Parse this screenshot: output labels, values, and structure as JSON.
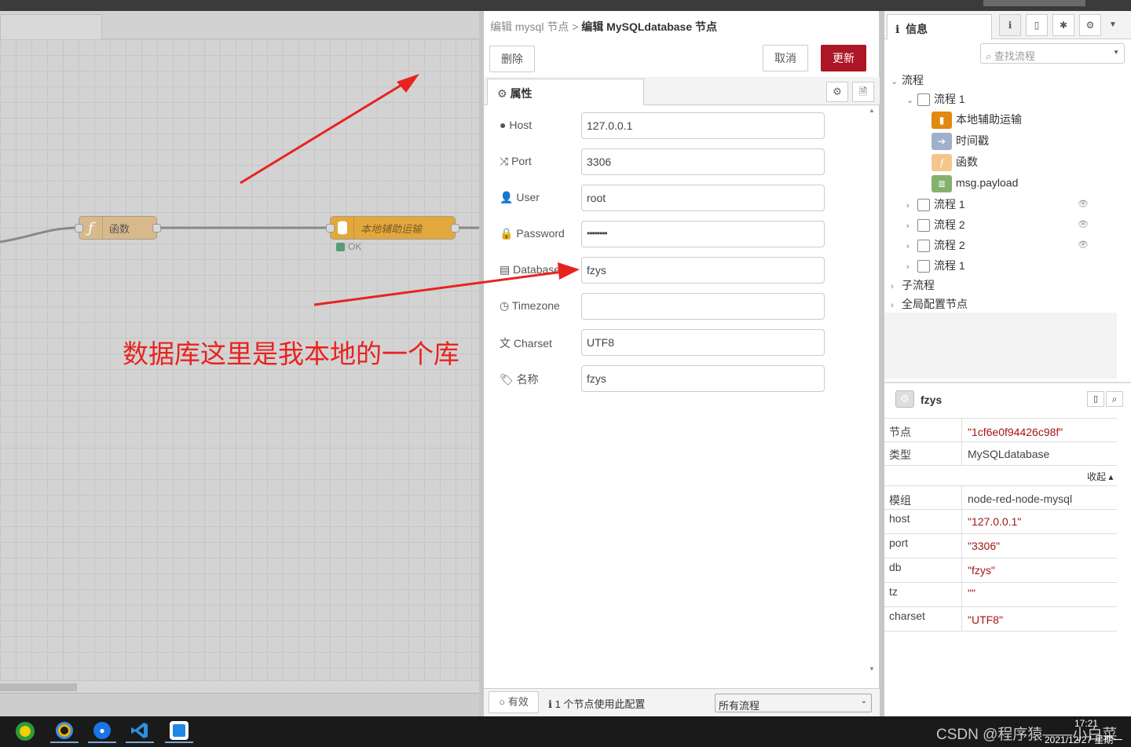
{
  "editor": {
    "breadcrumb_parent": "编辑 mysql 节点 >",
    "breadcrumb_current": "编辑 MySQLdatabase 节点",
    "delete_label": "删除",
    "cancel_label": "取消",
    "update_label": "更新",
    "tab_label": "属性",
    "fields": [
      {
        "icon": "globe-icon",
        "label": "Host",
        "value": "127.0.0.1"
      },
      {
        "icon": "random-icon",
        "label": "Port",
        "value": "3306"
      },
      {
        "icon": "user-icon",
        "label": "User",
        "value": "root"
      },
      {
        "icon": "lock-icon",
        "label": "Password",
        "value": "••••••••"
      },
      {
        "icon": "database-icon",
        "label": "Database",
        "value": "fzys"
      },
      {
        "icon": "clock-icon",
        "label": "Timezone",
        "value": ""
      },
      {
        "icon": "language-icon",
        "label": "Charset",
        "value": "UTF8"
      },
      {
        "icon": "tag-icon",
        "label": "名称",
        "value": "fzys"
      }
    ],
    "footer": {
      "enabled_label": "有效",
      "usage_text": "1 个节点使用此配置",
      "scope_select": "所有流程"
    }
  },
  "workspace": {
    "nodes": [
      {
        "label": "函数",
        "type": "function"
      },
      {
        "label": "本地辅助运输",
        "type": "mysql",
        "status": "OK"
      }
    ]
  },
  "annotation": {
    "text": "数据库这里是我本地的一个库"
  },
  "sidebar": {
    "tab_label": "信息",
    "search_placeholder": "查找流程",
    "tree": {
      "flows_label": "流程",
      "flow1_label": "流程 1",
      "flow1_nodes": [
        "本地辅助运输",
        "时间戳",
        "函数",
        "msg.payload"
      ],
      "other_flows": [
        "流程 1",
        "流程 2",
        "流程 2",
        "流程 1"
      ],
      "subflows_label": "子流程",
      "config_label": "全局配置节点"
    },
    "info": {
      "title": "fzys",
      "collapse_label": "收起 ▴",
      "props_top": [
        {
          "k": "节点",
          "v": "\"1cf6e0f94426c98f\"",
          "red": true
        },
        {
          "k": "类型",
          "v": "MySQLdatabase",
          "red": false
        }
      ],
      "props_bottom": [
        {
          "k": "模组",
          "v": "node-red-node-mysql",
          "red": false
        },
        {
          "k": "host",
          "v": "\"127.0.0.1\"",
          "red": true
        },
        {
          "k": "port",
          "v": "\"3306\"",
          "red": true
        },
        {
          "k": "db",
          "v": "\"fzys\"",
          "red": true
        },
        {
          "k": "tz",
          "v": "\"\"",
          "red": true
        },
        {
          "k": "charset",
          "v": "\"UTF8\"",
          "red": true
        }
      ]
    }
  },
  "taskbar": {
    "watermark": "CSDN @程序猿——小白菜",
    "time": "17:21",
    "date": "2021/12/27 星期一"
  },
  "colors": {
    "accent": "#ad1625",
    "annotation": "#e8231f",
    "mysql_node": "#e2a83c",
    "function_node": "#d8b98c"
  }
}
